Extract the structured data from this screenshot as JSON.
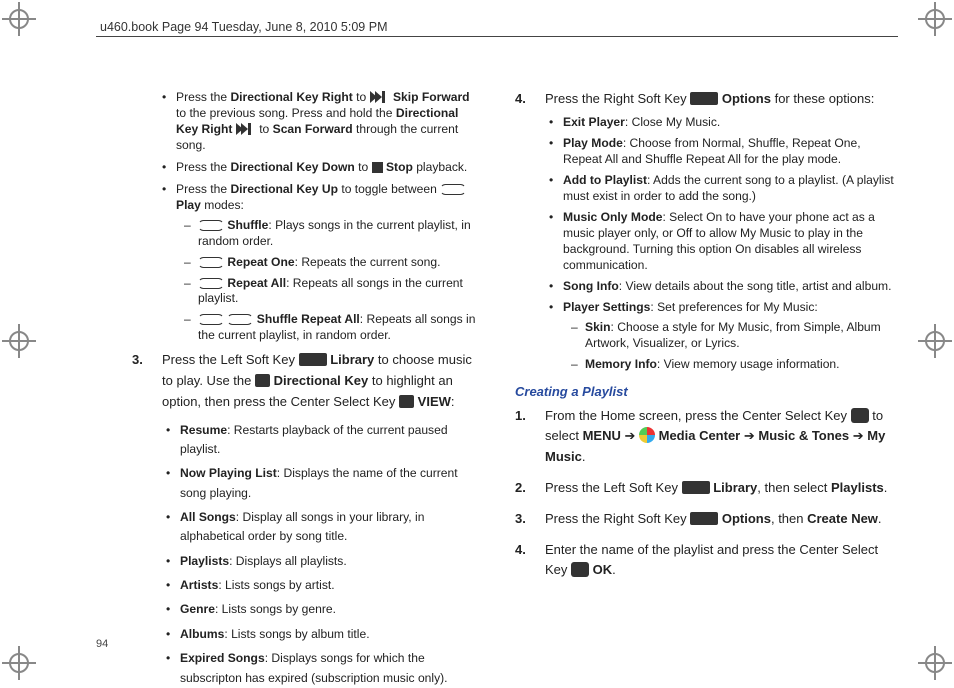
{
  "book_header": "u460.book  Page 94  Tuesday, June 8, 2010  5:09 PM",
  "col1": {
    "bullets1": [
      {
        "pre": "Press the ",
        "b1": "Directional Key Right",
        "mid": " to ",
        "icon": "ff",
        "post1": " ",
        "b2": "Skip Forward",
        "tail": " to the previous song. Press and hold the ",
        "b3": "Directional Key Right",
        "tail2": " ",
        "icon2": "ff",
        "tail3": " to ",
        "b4": "Scan Forward",
        "tail4": " through the current song."
      },
      {
        "pre": "Press the ",
        "b1": "Directional Key Down",
        "mid": " to ",
        "icon": "stop",
        "post1": " ",
        "b2": "Stop",
        "tail": " playback."
      },
      {
        "pre": "Press the ",
        "b1": "Directional Key Up",
        "mid": " to toggle between ",
        "icon": "rep",
        "post1": " ",
        "b2": "Play",
        "tail": " modes:",
        "sub": [
          {
            "icons": [
              "rep"
            ],
            "b": "Shuffle",
            "txt": ": Plays songs in the current playlist, in random order."
          },
          {
            "icons": [
              "rep"
            ],
            "b": "Repeat One",
            "txt": ": Repeats the current song."
          },
          {
            "icons": [
              "rep"
            ],
            "b": "Repeat All",
            "txt": ": Repeats all songs in the current playlist."
          },
          {
            "icons": [
              "rep",
              "rep"
            ],
            "b": "Shuffle Repeat All",
            "txt": ": Repeats all songs in the current playlist, in random order."
          }
        ]
      }
    ],
    "step3": {
      "num": "3.",
      "text1": "Press the Left Soft Key ",
      "lbl1": "Library",
      "text2": " to choose music to play. Use the ",
      "lbl2": "Directional Key",
      "text3": " to highlight an option, then press the Center Select Key ",
      "lbl3": "VIEW",
      "text4": ":",
      "bullets": [
        {
          "b": "Resume",
          "txt": ": Restarts playback of the current paused playlist."
        },
        {
          "b": "Now Playing List",
          "txt": ": Displays the name of the current song playing."
        },
        {
          "b": "All Songs",
          "txt": ": Display all songs in your library, in alphabetical order by song title."
        },
        {
          "b": "Playlists",
          "txt": ": Displays all playlists."
        },
        {
          "b": "Artists",
          "txt": ": Lists songs by artist."
        },
        {
          "b": "Genre",
          "txt": ": Lists songs by genre."
        },
        {
          "b": "Albums",
          "txt": ": Lists songs by album title."
        },
        {
          "b": "Expired Songs",
          "txt": ": Displays songs for which the subscripton has expired (subscription music only)."
        }
      ]
    }
  },
  "col2": {
    "step4": {
      "num": "4.",
      "text1": "Press the Right Soft Key ",
      "lbl1": "Options",
      "text2": " for these options:",
      "bullets": [
        {
          "b": "Exit Player",
          "txt": ": Close My Music."
        },
        {
          "b": "Play Mode",
          "txt": ": Choose from Normal, Shuffle, Repeat One, Repeat All and Shuffle Repeat All for the play mode."
        },
        {
          "b": "Add to Playlist",
          "txt": ": Adds the current song to a playlist. (A playlist must exist in order to add the song.)"
        },
        {
          "b": "Music Only Mode",
          "txt": ": Select On to have your phone act as a music player only, or Off to allow My Music to play in the background. Turning this option On disables all wireless communication."
        },
        {
          "b": "Song Info",
          "txt": ": View details about the song title, artist and album."
        },
        {
          "b": "Player Settings",
          "txt": ": Set preferences for My Music:",
          "sub": [
            {
              "b": "Skin",
              "txt": ": Choose a style for My Music, from Simple, Album Artwork, Visualizer, or Lyrics."
            },
            {
              "b": "Memory Info",
              "txt": ": View memory usage information."
            }
          ]
        }
      ]
    },
    "subhead": "Creating a Playlist",
    "create": [
      {
        "num": "1.",
        "parts": [
          "From the Home screen, press the Center Select Key ",
          {
            "icon": "center"
          },
          " to select ",
          {
            "b": "MENU"
          },
          " ➔ ",
          {
            "icon": "swirl"
          },
          " ",
          {
            "b": "Media Center"
          },
          " ➔ ",
          {
            "b": "Music & Tones"
          },
          " ➔ ",
          {
            "b": "My Music"
          },
          "."
        ]
      },
      {
        "num": "2.",
        "parts": [
          "Press the Left Soft Key ",
          {
            "icon": "key"
          },
          " ",
          {
            "b": "Library"
          },
          ", then select ",
          {
            "b": "Playlists"
          },
          "."
        ]
      },
      {
        "num": "3.",
        "parts": [
          "Press the Right Soft Key ",
          {
            "icon": "key"
          },
          " ",
          {
            "b": "Options"
          },
          ", then ",
          {
            "b": "Create New"
          },
          "."
        ]
      },
      {
        "num": "4.",
        "parts": [
          "Enter the name of the playlist and press the Center Select Key ",
          {
            "icon": "center"
          },
          " ",
          {
            "b": "OK"
          },
          "."
        ]
      }
    ]
  },
  "page_num": "94"
}
